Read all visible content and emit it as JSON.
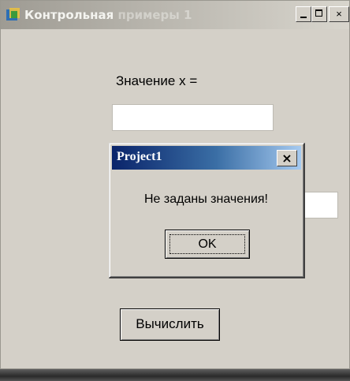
{
  "window": {
    "title": "Контрольная",
    "title_faded": " примеры 1",
    "icon": "delphi-app-icon",
    "buttons": {
      "minimize": "minimize-icon",
      "maximize": "maximize-icon",
      "close": "×"
    }
  },
  "form": {
    "label_x": "Значение х =",
    "input_x_value": "",
    "input_y_value": "",
    "calculate_label": "Вычислить"
  },
  "dialog": {
    "title": "Project1",
    "close_label": "×",
    "message": "Не заданы значения!",
    "ok_label": "OK"
  },
  "colors": {
    "face": "#d4d0c8",
    "dialog_title_start": "#0a246a",
    "dialog_title_end": "#a6caf0"
  }
}
